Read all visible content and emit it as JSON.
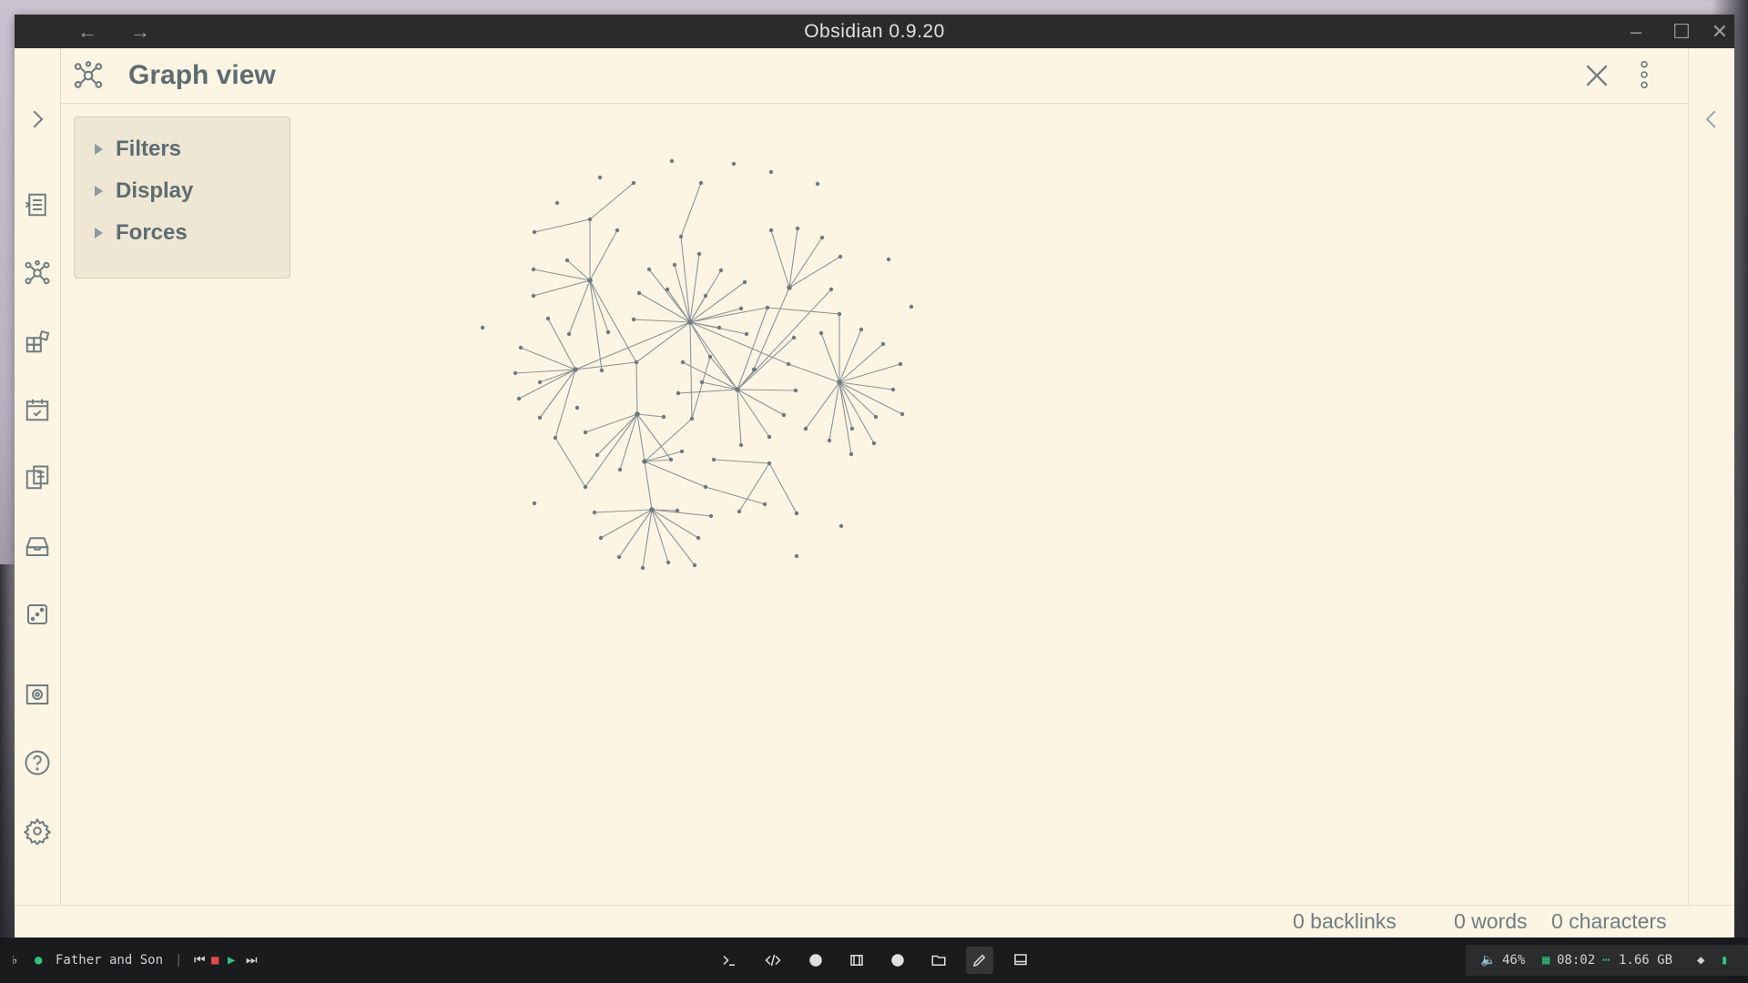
{
  "window": {
    "title": "Obsidian 0.9.20"
  },
  "pane": {
    "title": "Graph view"
  },
  "graph_controls": {
    "items": [
      "Filters",
      "Display",
      "Forces"
    ]
  },
  "status_bar": {
    "backlinks": "0 backlinks",
    "words": "0 words",
    "characters": "0 characters"
  },
  "taskbar": {
    "now_playing": "Father and Son",
    "volume": "46%",
    "time": "08:02",
    "memory": "1.66 GB"
  },
  "ribbon_icons": [
    "expand-sidebar-icon",
    "open-quick-switcher-icon",
    "graph-view-icon",
    "templates-icon",
    "daily-note-icon",
    "copy-notes-icon",
    "archive-icon",
    "random-note-icon",
    "slides-icon",
    "help-icon",
    "settings-icon"
  ],
  "colors": {
    "background": "#fcf5e3",
    "accent_text": "#5d6c72",
    "titlebar": "#2b2b2b"
  }
}
